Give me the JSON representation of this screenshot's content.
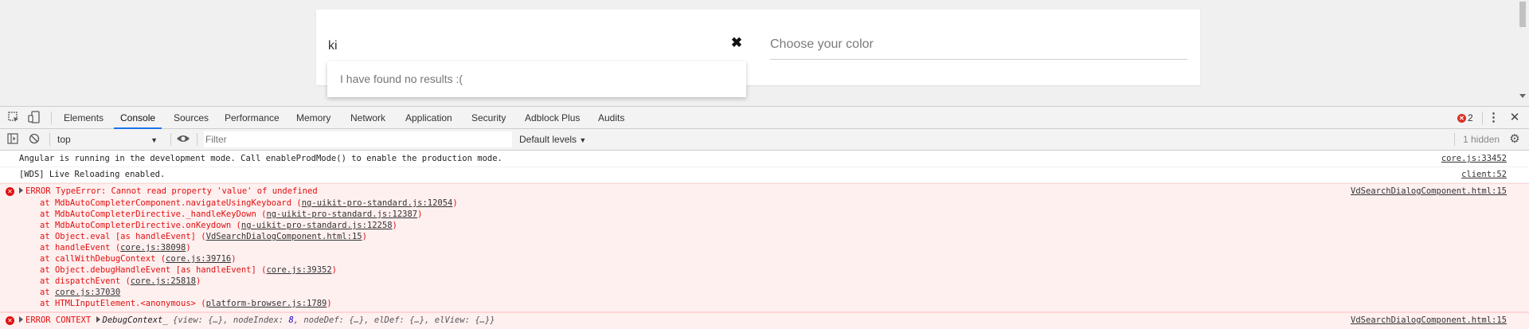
{
  "page": {
    "search_value": "ki",
    "clear_symbol": "✖",
    "color_placeholder": "Choose your color",
    "no_results_text": "I have found no results :("
  },
  "devtools": {
    "tabs": [
      {
        "label": "Elements"
      },
      {
        "label": "Console",
        "active": true
      },
      {
        "label": "Sources"
      },
      {
        "label": "Performance"
      },
      {
        "label": "Memory"
      },
      {
        "label": "Network"
      },
      {
        "label": "Application"
      },
      {
        "label": "Security"
      },
      {
        "label": "Adblock Plus"
      },
      {
        "label": "Audits"
      }
    ],
    "error_count": "2",
    "toolbar": {
      "context": "top",
      "filter_placeholder": "Filter",
      "levels": "Default levels",
      "hidden_count": "1 hidden"
    },
    "messages": {
      "angular": {
        "text": "Angular is running in the development mode. Call enableProdMode() to enable the production mode.",
        "source": "core.js:33452"
      },
      "wds": {
        "text": "[WDS] Live Reloading enabled.",
        "source": "client:52"
      },
      "error1": {
        "text": "ERROR TypeError: Cannot read property 'value' of undefined",
        "source": "VdSearchDialogComponent.html:15",
        "stack": [
          {
            "prefix": "at MdbAutoCompleterComponent.navigateUsingKeyboard (",
            "link": "ng-uikit-pro-standard.js:12054",
            "suffix": ")"
          },
          {
            "prefix": "at MdbAutoCompleterDirective._handleKeyDown (",
            "link": "ng-uikit-pro-standard.js:12387",
            "suffix": ")"
          },
          {
            "prefix": "at MdbAutoCompleterDirective.onKeydown (",
            "link": "ng-uikit-pro-standard.js:12258",
            "suffix": ")"
          },
          {
            "prefix": "at Object.eval [as handleEvent] (",
            "link": "VdSearchDialogComponent.html:15",
            "suffix": ")"
          },
          {
            "prefix": "at handleEvent (",
            "link": "core.js:38098",
            "suffix": ")"
          },
          {
            "prefix": "at callWithDebugContext (",
            "link": "core.js:39716",
            "suffix": ")"
          },
          {
            "prefix": "at Object.debugHandleEvent [as handleEvent] (",
            "link": "core.js:39352",
            "suffix": ")"
          },
          {
            "prefix": "at dispatchEvent (",
            "link": "core.js:25818",
            "suffix": ")"
          },
          {
            "prefix": "at ",
            "link": "core.js:37030",
            "suffix": ""
          },
          {
            "prefix": "at HTMLInputElement.<anonymous> (",
            "link": "platform-browser.js:1789",
            "suffix": ")"
          }
        ]
      },
      "error2": {
        "label": "ERROR CONTEXT",
        "detail": "DebugContext_",
        "obj_start": "{view: {…}, nodeIndex: ",
        "node_index": "8",
        "obj_end": ", nodeDef: {…}, elDef: {…}, elView: {…}}",
        "source": "VdSearchDialogComponent.html:15"
      }
    }
  }
}
